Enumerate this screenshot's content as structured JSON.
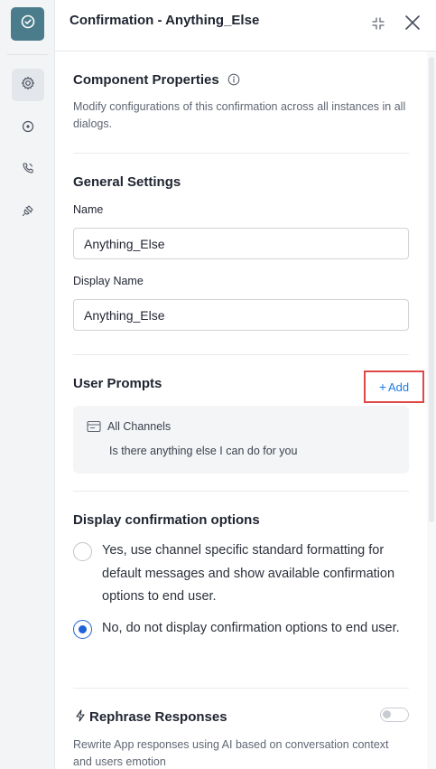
{
  "header": {
    "title": "Confirmation - Anything_Else"
  },
  "rail": {
    "logo_icon": "check-circle-icon",
    "items": [
      {
        "icon": "gear-icon",
        "active": true
      },
      {
        "icon": "target-icon",
        "active": false
      },
      {
        "icon": "phone-icon",
        "active": false
      },
      {
        "icon": "plug-icon",
        "active": false
      }
    ]
  },
  "component_properties": {
    "title": "Component Properties",
    "description": "Modify configurations of this confirmation across all instances in all dialogs."
  },
  "general_settings": {
    "title": "General Settings",
    "name_label": "Name",
    "name_value": "Anything_Else",
    "display_name_label": "Display Name",
    "display_name_value": "Anything_Else"
  },
  "user_prompts": {
    "title": "User Prompts",
    "add_label": "Add",
    "channel_label": "All Channels",
    "prompt_text": "Is there anything else I can do for you"
  },
  "display_options": {
    "title": "Display confirmation options",
    "options": [
      {
        "label": "Yes, use channel specific standard formatting for default messages and show available confirmation options to end user.",
        "selected": false
      },
      {
        "label": "No, do not display confirmation options to end user.",
        "selected": true
      }
    ]
  },
  "rephrase": {
    "title": "Rephrase Responses",
    "description": "Rewrite App responses using AI based on conversation context and users emotion",
    "enabled": false
  },
  "colors": {
    "accent": "#1e7ce8",
    "highlight_border": "#e04848",
    "logo_bg": "#4a7c8c"
  }
}
